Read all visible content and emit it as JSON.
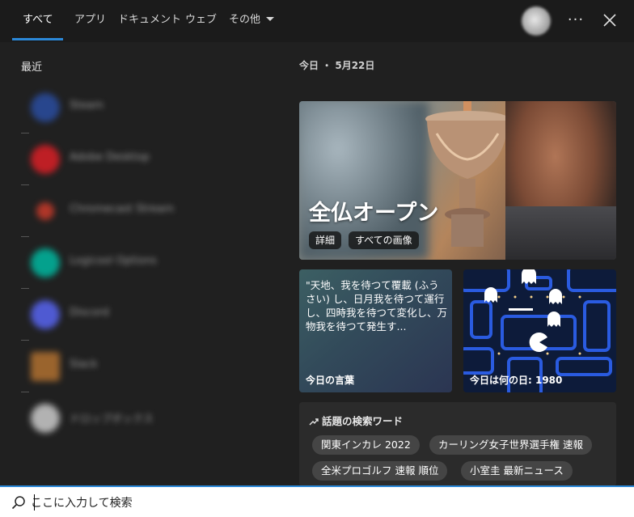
{
  "tabs": [
    {
      "label": "すべて",
      "active": true
    },
    {
      "label": "アプリ"
    },
    {
      "label": "ドキュメント"
    },
    {
      "label": "ウェブ"
    },
    {
      "label": "その他"
    }
  ],
  "header": {
    "more_label": "···"
  },
  "recent": {
    "title": "最近",
    "items": [
      {
        "label": "Steam",
        "color": "#2a4da0"
      },
      {
        "label": "Adobe Desktop",
        "color": "#da1f26"
      },
      {
        "label": "Chromecast Stream",
        "color": "#c83a2a"
      },
      {
        "label": "Logicool Options",
        "color": "#00b8a0"
      },
      {
        "label": "Discord",
        "color": "#5865f2"
      },
      {
        "label": "Slack",
        "color": "#b07030"
      },
      {
        "label": "ドロップボックス",
        "color": "#cccccc"
      }
    ]
  },
  "today": {
    "date_label": "今日 ・ 5月22日",
    "hero": {
      "title": "全仏オープン",
      "details_button": "詳細",
      "all_images_button": "すべての画像"
    },
    "quote": {
      "text": "\"天地、我を待つて覆載 (ふうさい) し、日月我を待つて運行し、四時我を待つて変化し、万物我を待つて発生す...",
      "label": "今日の言葉"
    },
    "history": {
      "label": "今日は何の日: 1980"
    },
    "trending": {
      "title": "話題の検索ワード",
      "chips": [
        "関東インカレ 2022",
        "カーリング女子世界選手権 速報",
        "全米プロゴルフ 速報 順位",
        "小室圭 最新ニュース"
      ]
    }
  },
  "search": {
    "placeholder": "ここに入力して検索"
  },
  "colors": {
    "accent": "#2b88d8",
    "background": "#202020"
  }
}
